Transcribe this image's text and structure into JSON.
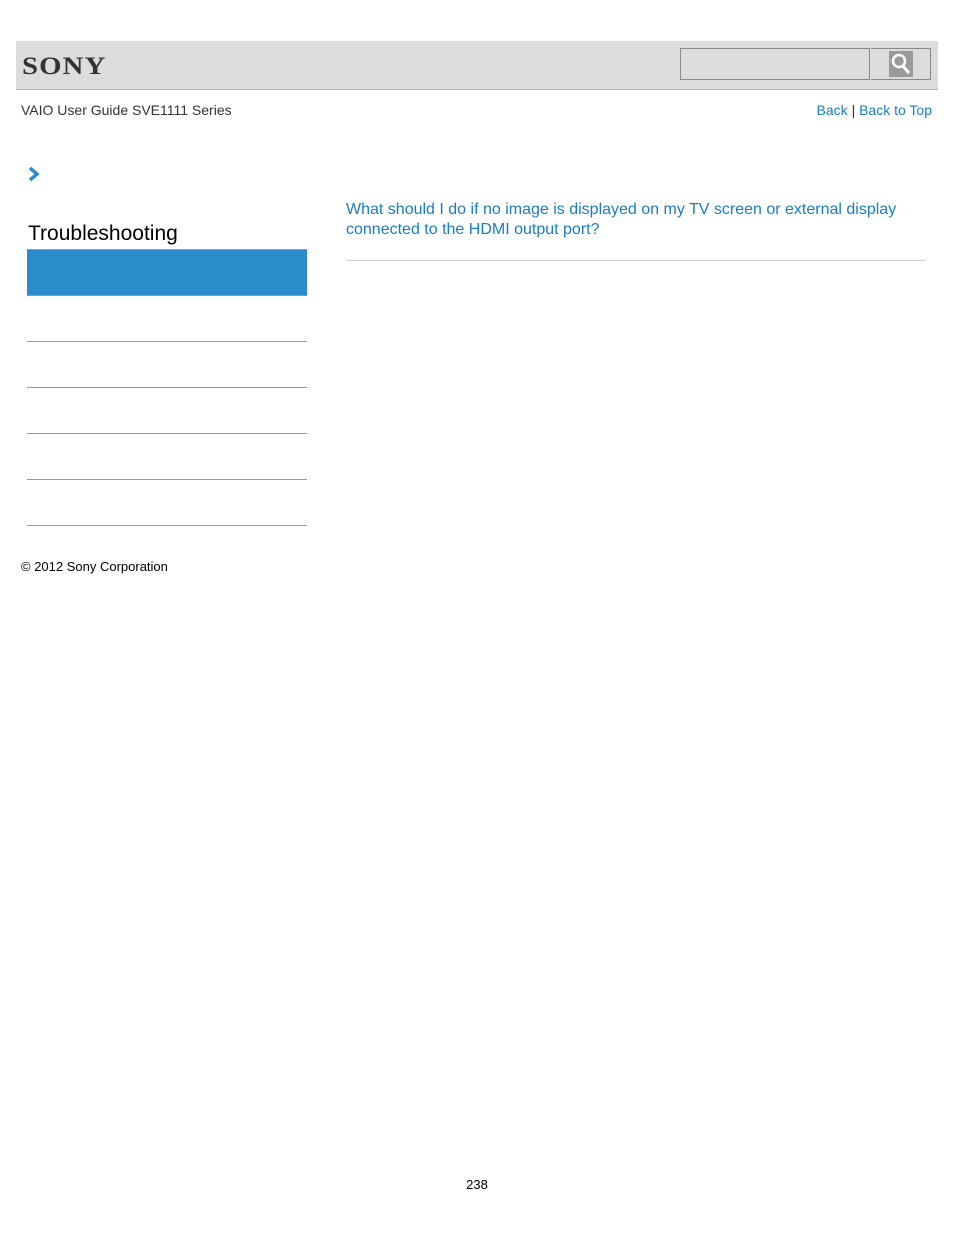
{
  "header": {
    "brand": "SONY",
    "search": {
      "placeholder": "",
      "value": "",
      "button_icon": "search-icon"
    }
  },
  "guide_title": "VAIO User Guide SVE1111 Series",
  "nav_links": {
    "back": "Back",
    "separator": "|",
    "back_to_top": "Back to Top"
  },
  "breadcrumb_icon": "chevron-right-icon",
  "sidebar": {
    "title": "Troubleshooting",
    "items": [
      "",
      "",
      "",
      "",
      "",
      ""
    ]
  },
  "main": {
    "link": "What should I do if no image is displayed on my TV screen or external display connected to the HDMI output port?"
  },
  "footer": {
    "copyright": "© 2012 Sony Corporation",
    "page_number": "238"
  },
  "colors": {
    "accent": "#2a8ccb",
    "link": "#1a7dc4",
    "header_bg": "#dcdcdc"
  }
}
